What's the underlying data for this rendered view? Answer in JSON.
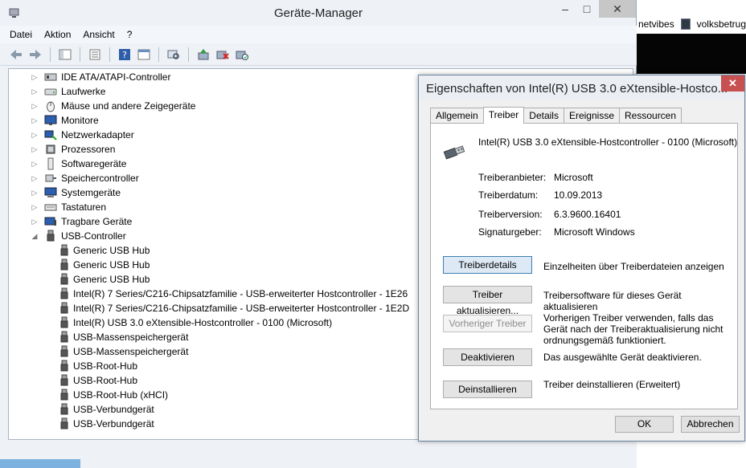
{
  "background": {
    "tab1": "netvibes",
    "tab2": "volksbetrug"
  },
  "window": {
    "title": "Geräte-Manager",
    "minimize": "–",
    "maximize": "□",
    "close": "✕"
  },
  "menu": [
    "Datei",
    "Aktion",
    "Ansicht",
    "?"
  ],
  "tree": {
    "categories": [
      {
        "label": "IDE ATA/ATAPI-Controller",
        "icon": "ide-controller-icon"
      },
      {
        "label": "Laufwerke",
        "icon": "drive-icon"
      },
      {
        "label": "Mäuse und andere Zeigegeräte",
        "icon": "mouse-icon"
      },
      {
        "label": "Monitore",
        "icon": "monitor-icon"
      },
      {
        "label": "Netzwerkadapter",
        "icon": "network-adapter-icon"
      },
      {
        "label": "Prozessoren",
        "icon": "processor-icon"
      },
      {
        "label": "Softwaregeräte",
        "icon": "software-device-icon"
      },
      {
        "label": "Speichercontroller",
        "icon": "storage-controller-icon"
      },
      {
        "label": "Systemgeräte",
        "icon": "system-device-icon"
      },
      {
        "label": "Tastaturen",
        "icon": "keyboard-icon"
      },
      {
        "label": "Tragbare Geräte",
        "icon": "portable-device-icon"
      },
      {
        "label": "USB-Controller",
        "icon": "usb-icon",
        "expanded": true
      }
    ],
    "usb_children": [
      "Generic USB Hub",
      "Generic USB Hub",
      "Generic USB Hub",
      "Intel(R) 7 Series/C216-Chipsatzfamilie - USB-erweiterter Hostcontroller - 1E26",
      "Intel(R) 7 Series/C216-Chipsatzfamilie - USB-erweiterter Hostcontroller - 1E2D",
      "Intel(R) USB 3.0 eXtensible-Hostcontroller - 0100 (Microsoft)",
      "USB-Massenspeichergerät",
      "USB-Massenspeichergerät",
      "USB-Root-Hub",
      "USB-Root-Hub",
      "USB-Root-Hub (xHCI)",
      "USB-Verbundgerät",
      "USB-Verbundgerät"
    ]
  },
  "dialog": {
    "title": "Eigenschaften von Intel(R) USB 3.0 eXtensible-Hostco...",
    "close": "✕",
    "tabs": [
      "Allgemein",
      "Treiber",
      "Details",
      "Ereignisse",
      "Ressourcen"
    ],
    "active_tab": "Treiber",
    "device_name": "Intel(R) USB 3.0 eXtensible-Hostcontroller - 0100 (Microsoft)",
    "props": [
      {
        "label": "Treiberanbieter:",
        "value": "Microsoft"
      },
      {
        "label": "Treiberdatum:",
        "value": "10.09.2013"
      },
      {
        "label": "Treiberversion:",
        "value": "6.3.9600.16401"
      },
      {
        "label": "Signaturgeber:",
        "value": "Microsoft Windows"
      }
    ],
    "actions": [
      {
        "button": "Treiberdetails",
        "desc": "Einzelheiten über Treiberdateien anzeigen",
        "enabled": true
      },
      {
        "button": "Treiber aktualisieren...",
        "desc": "Treibersoftware für dieses Gerät aktualisieren",
        "enabled": true
      },
      {
        "button": "Vorheriger Treiber",
        "desc": "Vorherigen Treiber verwenden, falls das Gerät nach der Treiberaktualisierung nicht ordnungsgemäß funktioniert.",
        "enabled": false
      },
      {
        "button": "Deaktivieren",
        "desc": "Das ausgewählte Gerät deaktivieren.",
        "enabled": true
      },
      {
        "button": "Deinstallieren",
        "desc": "Treiber deinstallieren (Erweitert)",
        "enabled": true
      }
    ],
    "ok": "OK",
    "cancel": "Abbrechen"
  }
}
